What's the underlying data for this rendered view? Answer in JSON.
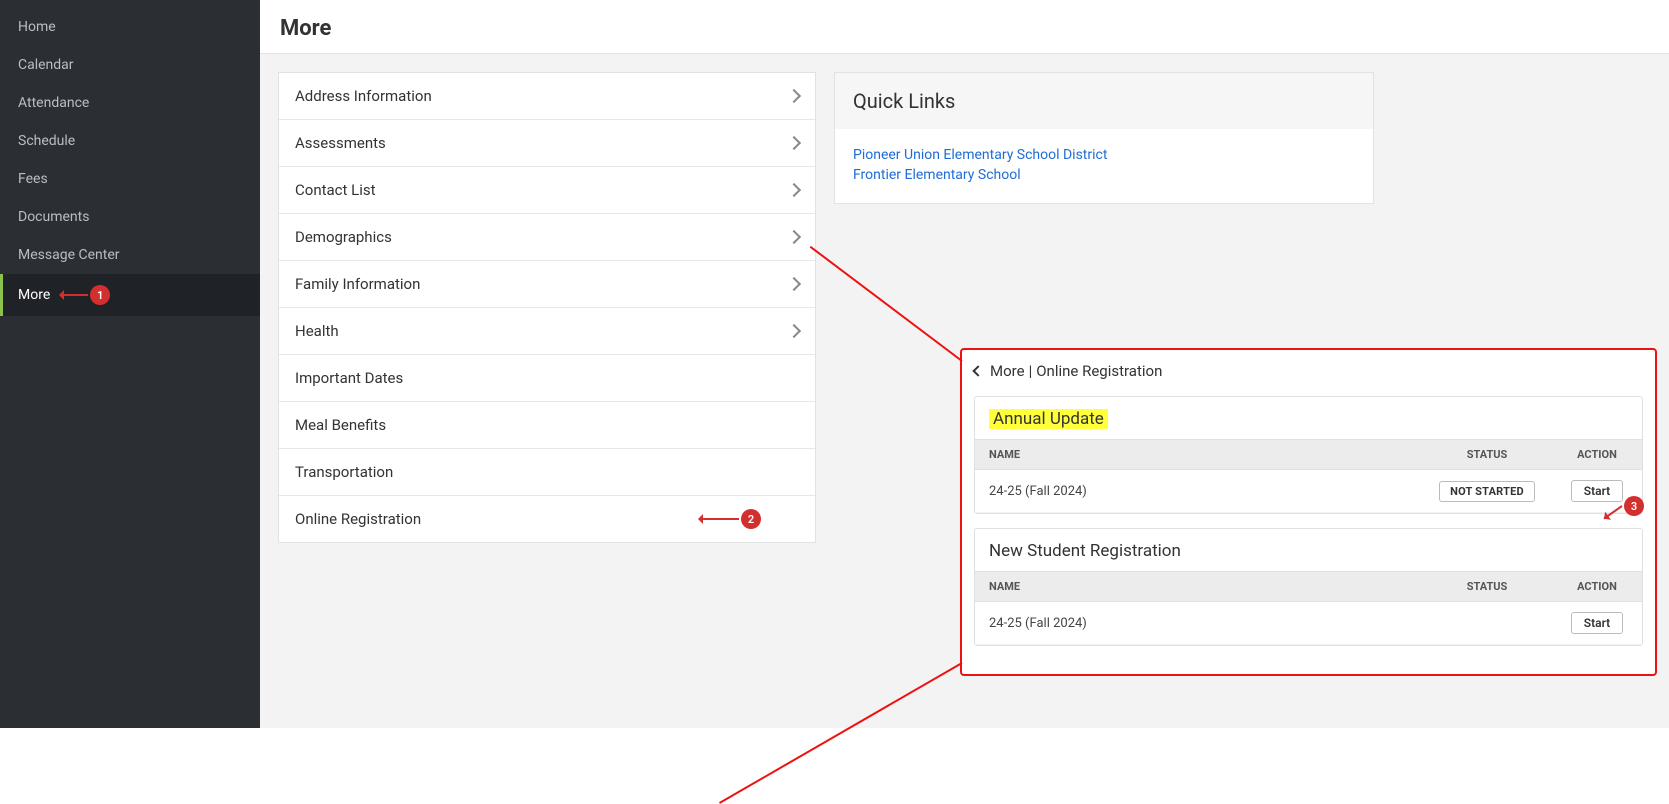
{
  "sidebar": {
    "items": [
      {
        "label": "Home"
      },
      {
        "label": "Calendar"
      },
      {
        "label": "Attendance"
      },
      {
        "label": "Schedule"
      },
      {
        "label": "Fees"
      },
      {
        "label": "Documents"
      },
      {
        "label": "Message Center"
      },
      {
        "label": "More"
      }
    ]
  },
  "page": {
    "title": "More"
  },
  "more_menu": {
    "items": [
      {
        "label": "Address Information",
        "chevron": true
      },
      {
        "label": "Assessments",
        "chevron": true
      },
      {
        "label": "Contact List",
        "chevron": true
      },
      {
        "label": "Demographics",
        "chevron": true
      },
      {
        "label": "Family Information",
        "chevron": true
      },
      {
        "label": "Health",
        "chevron": true
      },
      {
        "label": "Important Dates",
        "chevron": false
      },
      {
        "label": "Meal Benefits",
        "chevron": false
      },
      {
        "label": "Transportation",
        "chevron": false
      },
      {
        "label": "Online Registration",
        "chevron": false
      }
    ]
  },
  "quick_links": {
    "title": "Quick Links",
    "links": [
      {
        "label": "Pioneer Union Elementary School District"
      },
      {
        "label": "Frontier Elementary School"
      }
    ]
  },
  "callout": {
    "breadcrumb": {
      "parent": "More",
      "separator": "|",
      "current": "Online Registration"
    },
    "annual": {
      "title": "Annual Update",
      "columns": {
        "name": "NAME",
        "status": "STATUS",
        "action": "ACTION"
      },
      "row": {
        "name": "24-25 (Fall 2024)",
        "status": "NOT STARTED",
        "action": "Start"
      }
    },
    "newstudent": {
      "title": "New Student Registration",
      "columns": {
        "name": "NAME",
        "status": "STATUS",
        "action": "ACTION"
      },
      "row": {
        "name": "24-25 (Fall 2024)",
        "status": "",
        "action": "Start"
      }
    }
  },
  "annotations": {
    "n1": "1",
    "n2": "2",
    "n3": "3"
  }
}
